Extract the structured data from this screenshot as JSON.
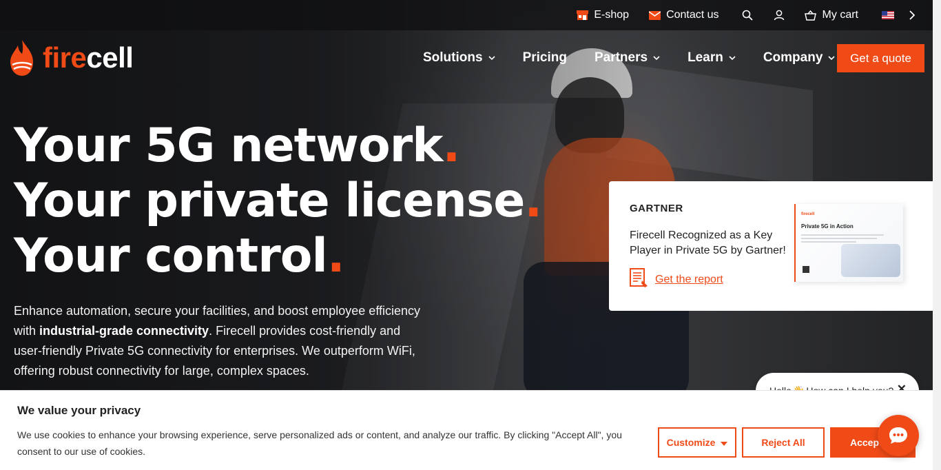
{
  "topbar": {
    "eshop_label": "E-shop",
    "contact_label": "Contact us",
    "cart_label": "My cart"
  },
  "logo": {
    "prefix": "fire",
    "suffix": "cell"
  },
  "nav": {
    "items": [
      {
        "label": "Solutions",
        "has_dropdown": true
      },
      {
        "label": "Pricing",
        "has_dropdown": false
      },
      {
        "label": "Partners",
        "has_dropdown": true
      },
      {
        "label": "Learn",
        "has_dropdown": true
      },
      {
        "label": "Company",
        "has_dropdown": true
      }
    ],
    "cta_label": "Get a quote"
  },
  "hero": {
    "line1": "Your 5G network",
    "line2": "Your private license",
    "line3": "Your control",
    "dot": ".",
    "intro_before": "Enhance automation, secure your facilities, and boost employee efficiency with ",
    "intro_bold": "industrial-grade connectivity",
    "intro_after": ". Firecell provides cost-friendly and user-friendly Private 5G connectivity for enterprises. We outperform WiFi, offering robust connectivity for large, complex spaces."
  },
  "gartner": {
    "tag": "GARTNER",
    "title": "Firecell Recognized as a Key Player in Private 5G by Gartner!",
    "link_label": "Get the report",
    "report_logo": "firecell",
    "report_title": "Private 5G in Action"
  },
  "chat": {
    "greeting_before": "Hello",
    "wave": "👋",
    "greeting_after": "How can I help you?",
    "close": "✕"
  },
  "cookie": {
    "title": "We value your privacy",
    "text": "We use cookies to enhance your browsing experience, serve personalized ads or content, and analyze our traffic. By clicking \"Accept All\", you consent to our use of cookies.",
    "customize_label": "Customize",
    "reject_label": "Reject All",
    "accept_label": "Accept All"
  },
  "colors": {
    "accent": "#f04a17",
    "topbar_bg": "#0f1012",
    "card_bg": "#ffffff"
  },
  "icons": {
    "eshop": "shop-icon",
    "contact": "mail-icon",
    "search": "search-icon",
    "account": "user-icon",
    "cart": "basket-icon",
    "language": "us-flag-icon",
    "language_chevron": "chevron-right-icon",
    "nav_chevron": "chevron-down-icon",
    "report": "document-icon",
    "chat": "chat-icon"
  }
}
